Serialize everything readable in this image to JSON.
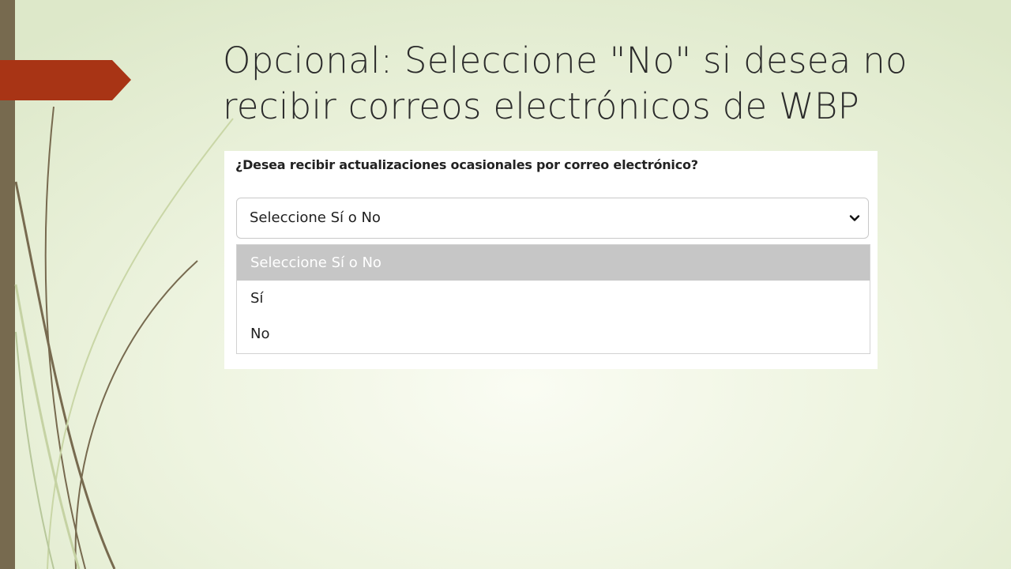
{
  "slide": {
    "title": "Opcional: Seleccione \"No\" si desea no\nrecibir correos electrónicos de WBP"
  },
  "form": {
    "question": "¿Desea recibir actualizaciones ocasionales por correo electrónico?",
    "select": {
      "value": "Seleccione Sí o No",
      "icon": "chevron-down-icon",
      "options": [
        {
          "label": "Seleccione Sí o No",
          "highlighted": true
        },
        {
          "label": "Sí",
          "highlighted": false
        },
        {
          "label": "No",
          "highlighted": false
        }
      ]
    }
  },
  "colors": {
    "accent_arrow": "#a83415",
    "left_bar": "#776a4f",
    "option_highlight": "#c6c6c6"
  }
}
